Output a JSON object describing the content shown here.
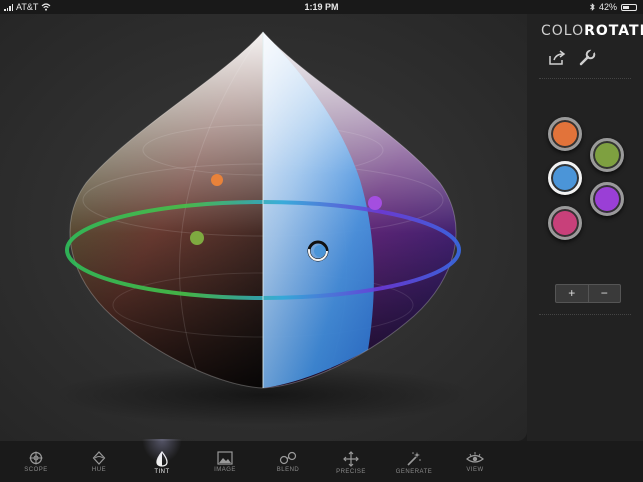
{
  "status": {
    "carrier": "AT&T",
    "time": "1:19 PM",
    "battery": "42%"
  },
  "app": {
    "title_light": "COLO",
    "title_bold": "ROTATE"
  },
  "toolbar": {
    "share_icon": "share-icon",
    "settings_icon": "wrench-icon"
  },
  "swatches": [
    {
      "name": "orange",
      "color": "#e2733a",
      "selected": false
    },
    {
      "name": "green",
      "color": "#7ea040",
      "selected": false
    },
    {
      "name": "blue",
      "color": "#4b95d8",
      "selected": true
    },
    {
      "name": "purple",
      "color": "#9a3fd6",
      "selected": false
    },
    {
      "name": "pink",
      "color": "#c8407a",
      "selected": false
    }
  ],
  "stepper": {
    "plus": "+",
    "minus": "−"
  },
  "tabs": [
    {
      "label": "SCOPE",
      "icon": "scope-icon",
      "active": false
    },
    {
      "label": "HUE",
      "icon": "hue-icon",
      "active": false
    },
    {
      "label": "TINT",
      "icon": "tint-icon",
      "active": true
    },
    {
      "label": "IMAGE",
      "icon": "image-icon",
      "active": false
    },
    {
      "label": "BLEND",
      "icon": "blend-icon",
      "active": false
    },
    {
      "label": "PRECISE",
      "icon": "precise-icon",
      "active": false
    },
    {
      "label": "GENERATE",
      "icon": "generate-icon",
      "active": false
    },
    {
      "label": "VIEW",
      "icon": "view-icon",
      "active": false
    }
  ]
}
